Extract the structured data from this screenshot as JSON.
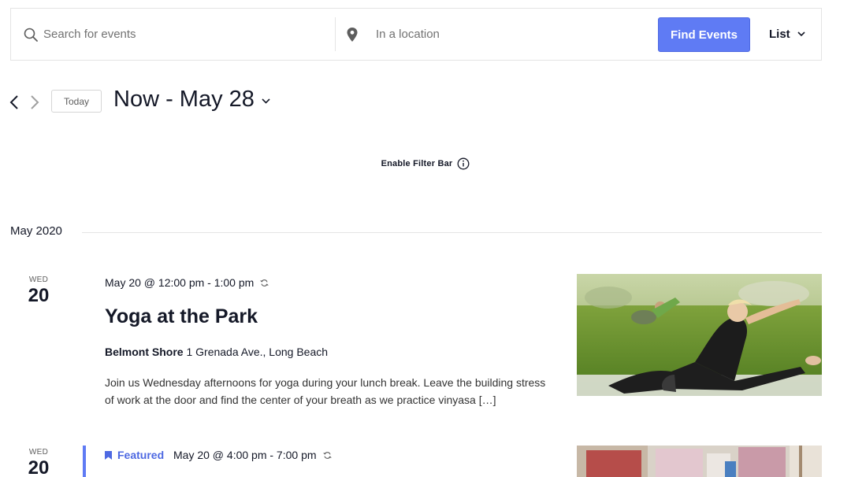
{
  "search": {
    "placeholder": "Search for events",
    "location_placeholder": "In a location",
    "find_button": "Find Events",
    "view_label": "List"
  },
  "nav": {
    "today_label": "Today",
    "date_range": "Now - May 28"
  },
  "filter_bar": {
    "label": "Enable Filter Bar"
  },
  "month_separator": "May 2020",
  "events": [
    {
      "day_of_week": "WED",
      "day_number": "20",
      "time": "May 20 @ 12:00 pm - 1:00 pm",
      "title": "Yoga at the Park",
      "venue_name": "Belmont Shore",
      "venue_address": "1 Grenada Ave., Long Beach",
      "description": "Join us Wednesday afternoons for yoga during your lunch break. Leave the building stress of work at the door and find the center of your breath as we practice vinyasa […]",
      "image": "yoga-in-park-photo"
    },
    {
      "day_of_week": "WED",
      "day_number": "20",
      "featured_label": "Featured",
      "time": "May 20 @ 4:00 pm - 7:00 pm",
      "image": "event-photo"
    }
  ],
  "colors": {
    "accent": "#5f7bf4",
    "text": "#141827",
    "border": "#e4e4e4"
  },
  "icons": [
    "search-icon",
    "location-pin-icon",
    "chevron-down-icon",
    "chevron-left-icon",
    "chevron-right-icon",
    "info-icon",
    "recurring-icon",
    "featured-flag-icon"
  ]
}
